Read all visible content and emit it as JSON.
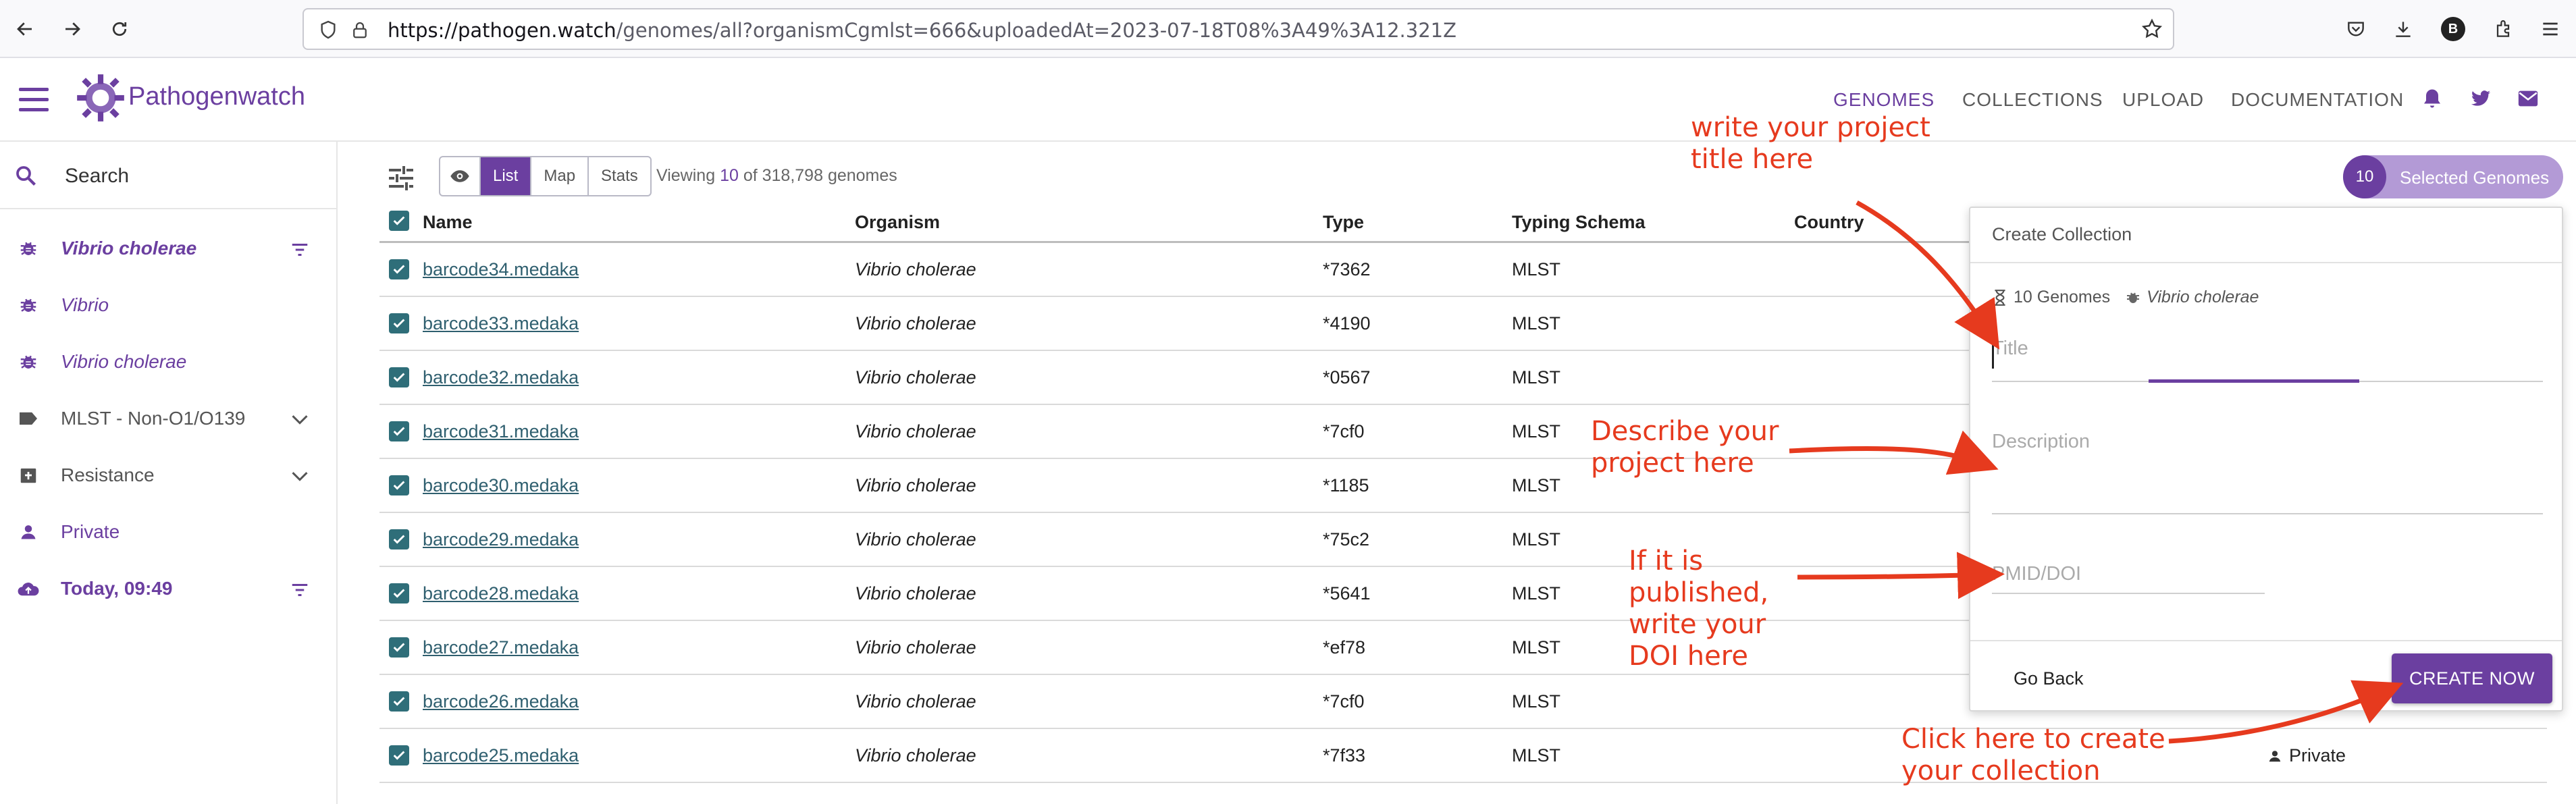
{
  "browser": {
    "url_host": "https://pathogen.watch",
    "url_path": "/genomes/all?organismCgmlst=666&uploadedAt=2023-07-18T08%3A49%3A12.321Z",
    "profile_initial": "B"
  },
  "header": {
    "logo_text": "Pathogenwatch",
    "nav": [
      "GENOMES",
      "COLLECTIONS",
      "UPLOAD",
      "DOCUMENTATION"
    ],
    "active_nav": "GENOMES"
  },
  "sidebar": {
    "search_label": "Search",
    "items": [
      {
        "label": "Vibrio cholerae",
        "icon": "bug-icon"
      },
      {
        "label": "Vibrio",
        "icon": "bug-icon"
      },
      {
        "label": "Vibrio cholerae",
        "icon": "bug-icon"
      },
      {
        "label": "MLST - Non-O1/O139",
        "icon": "label-icon"
      },
      {
        "label": "Resistance",
        "icon": "shield-icon"
      },
      {
        "label": "Private",
        "icon": "person-icon"
      },
      {
        "label": "Today, 09:49",
        "icon": "cloud-upload-icon"
      }
    ]
  },
  "toolbar": {
    "views": [
      "List",
      "Map",
      "Stats"
    ],
    "active_view": "List",
    "viewing_prefix": "Viewing",
    "viewing_count": "10",
    "viewing_suffix": "of 318,798 genomes",
    "selected_count": "10",
    "selected_label": "Selected Genomes"
  },
  "table": {
    "columns": [
      "Name",
      "Organism",
      "Type",
      "Typing Schema",
      "Country"
    ],
    "rows": [
      {
        "name": "barcode34.medaka",
        "organism": "Vibrio cholerae",
        "type": "*7362",
        "schema": "MLST"
      },
      {
        "name": "barcode33.medaka",
        "organism": "Vibrio cholerae",
        "type": "*4190",
        "schema": "MLST"
      },
      {
        "name": "barcode32.medaka",
        "organism": "Vibrio cholerae",
        "type": "*0567",
        "schema": "MLST"
      },
      {
        "name": "barcode31.medaka",
        "organism": "Vibrio cholerae",
        "type": "*7cf0",
        "schema": "MLST"
      },
      {
        "name": "barcode30.medaka",
        "organism": "Vibrio cholerae",
        "type": "*1185",
        "schema": "MLST"
      },
      {
        "name": "barcode29.medaka",
        "organism": "Vibrio cholerae",
        "type": "*75c2",
        "schema": "MLST"
      },
      {
        "name": "barcode28.medaka",
        "organism": "Vibrio cholerae",
        "type": "*5641",
        "schema": "MLST"
      },
      {
        "name": "barcode27.medaka",
        "organism": "Vibrio cholerae",
        "type": "*ef78",
        "schema": "MLST"
      },
      {
        "name": "barcode26.medaka",
        "organism": "Vibrio cholerae",
        "type": "*7cf0",
        "schema": "MLST"
      },
      {
        "name": "barcode25.medaka",
        "organism": "Vibrio cholerae",
        "type": "*7f33",
        "schema": "MLST",
        "access": "Private"
      }
    ]
  },
  "collection_panel": {
    "title": "Create Collection",
    "genome_count": "10 Genomes",
    "organism": "Vibrio cholerae",
    "title_placeholder": "Title",
    "description_placeholder": "Description",
    "pmid_placeholder": "PMID/DOI",
    "go_back": "Go Back",
    "create_now": "CREATE NOW"
  },
  "annotations": {
    "title_hint": "write your project\ntitle here",
    "description_hint": "Describe your\nproject here",
    "doi_hint": "If it is\npublished,\nwrite your\nDOI here",
    "create_hint": "Click here to create\nyour collection"
  },
  "colors": {
    "brand": "#6b3fa0",
    "annotation": "#e63a1e",
    "checkbox": "#2f6e79"
  }
}
